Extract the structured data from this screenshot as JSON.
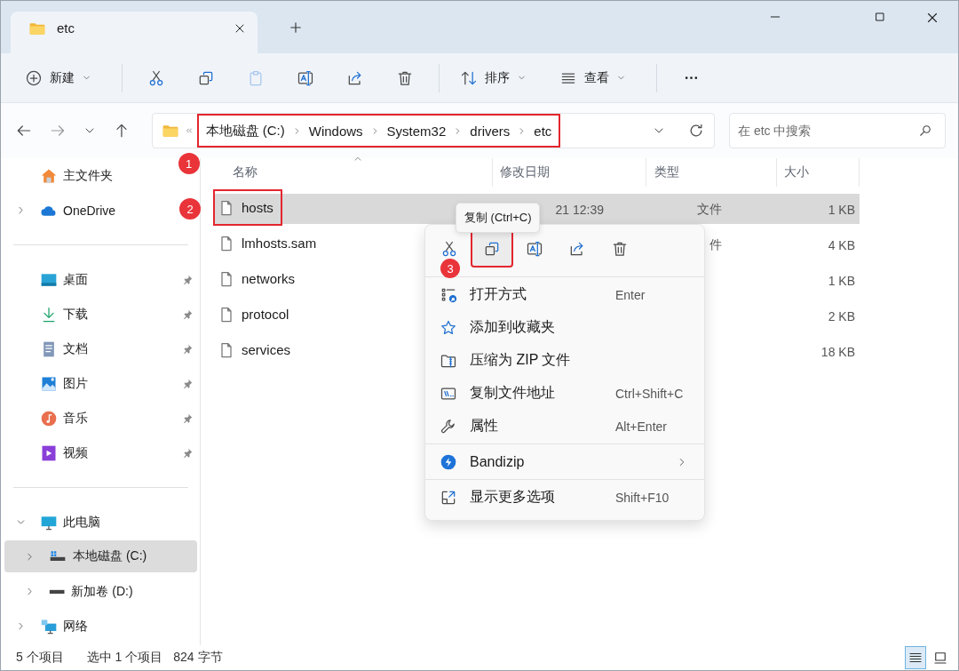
{
  "window": {
    "tab_title": "etc"
  },
  "toolbar": {
    "new_label": "新建",
    "actions": [
      {
        "kind": "cut",
        "disabled": false
      },
      {
        "kind": "copy",
        "disabled": false
      },
      {
        "kind": "paste",
        "disabled": true
      },
      {
        "kind": "rename",
        "disabled": false
      },
      {
        "kind": "share",
        "disabled": false
      },
      {
        "kind": "delete",
        "disabled": false
      }
    ],
    "sort_label": "排序",
    "view_label": "查看"
  },
  "address": {
    "path": [
      "本地磁盘 (C:)",
      "Windows",
      "System32",
      "drivers",
      "etc"
    ],
    "outlined": true,
    "marker": "1"
  },
  "search": {
    "placeholder": "在 etc 中搜索"
  },
  "sidebar": {
    "sections": [
      [
        {
          "kind": "home",
          "label": "主文件夹",
          "selected": false
        },
        {
          "kind": "cloud",
          "label": "OneDrive",
          "expanded": false,
          "selected": false
        }
      ],
      [
        {
          "kind": "desktop",
          "label": "桌面",
          "pinned": true,
          "selected": false
        },
        {
          "kind": "download",
          "label": "下载",
          "pinned": true,
          "selected": false
        },
        {
          "kind": "docs",
          "label": "文档",
          "pinned": true,
          "selected": false
        },
        {
          "kind": "pictures",
          "label": "图片",
          "pinned": true,
          "selected": false
        },
        {
          "kind": "music",
          "label": "音乐",
          "pinned": true,
          "selected": false
        },
        {
          "kind": "video",
          "label": "视频",
          "pinned": true,
          "selected": false
        }
      ],
      [
        {
          "kind": "pc",
          "label": "此电脑",
          "expanded": true,
          "selected": false,
          "children": [
            {
              "kind": "system-drive",
              "label": "本地磁盘 (C:)",
              "expanded": false,
              "selected": true
            },
            {
              "kind": "drive",
              "label": "新加卷 (D:)",
              "expanded": false,
              "selected": false
            }
          ]
        },
        {
          "kind": "network",
          "label": "网络",
          "expanded": false,
          "selected": false
        }
      ]
    ]
  },
  "columns": [
    {
      "label": "名称",
      "sorted": true
    },
    {
      "label": "修改日期",
      "sorted": false
    },
    {
      "label": "类型",
      "sorted": false
    },
    {
      "label": "大小",
      "sorted": false
    }
  ],
  "files": [
    {
      "name": "hosts",
      "date": "21 12:39",
      "type": "文件",
      "size": "1 KB",
      "selected": true,
      "outlined": true,
      "marker": "2"
    },
    {
      "name": "lmhosts.sam",
      "type": "件",
      "size": "4 KB",
      "selected": false
    },
    {
      "name": "networks",
      "size": "1 KB",
      "selected": false
    },
    {
      "name": "protocol",
      "size": "2 KB",
      "selected": false
    },
    {
      "name": "services",
      "size": "18 KB",
      "selected": false
    }
  ],
  "tooltip": "复制 (Ctrl+C)",
  "context_menu": {
    "quick_actions": [
      {
        "kind": "cut",
        "hovered": false
      },
      {
        "kind": "copy",
        "hovered": true,
        "outlined": true,
        "marker": "3"
      },
      {
        "kind": "rename",
        "hovered": false
      },
      {
        "kind": "share",
        "hovered": false
      },
      {
        "kind": "delete",
        "hovered": false
      }
    ],
    "groups": [
      [
        {
          "kind": "open-with",
          "label": "打开方式",
          "shortcut": "Enter"
        },
        {
          "kind": "star",
          "label": "添加到收藏夹"
        },
        {
          "kind": "zip",
          "label": "压缩为 ZIP 文件"
        },
        {
          "kind": "path",
          "label": "复制文件地址",
          "shortcut": "Ctrl+Shift+C"
        },
        {
          "kind": "wrench",
          "label": "属性",
          "shortcut": "Alt+Enter"
        }
      ],
      [
        {
          "kind": "bandizip",
          "label": "Bandizip",
          "submenu": true
        }
      ],
      [
        {
          "kind": "more-options",
          "label": "显示更多选项",
          "shortcut": "Shift+F10"
        }
      ]
    ]
  },
  "status_bar": {
    "count": "5 个项目",
    "selection": "选中 1 个项目",
    "size": "824 字节",
    "views": [
      {
        "kind": "details",
        "selected": true
      },
      {
        "kind": "tiles",
        "selected": false
      }
    ]
  }
}
